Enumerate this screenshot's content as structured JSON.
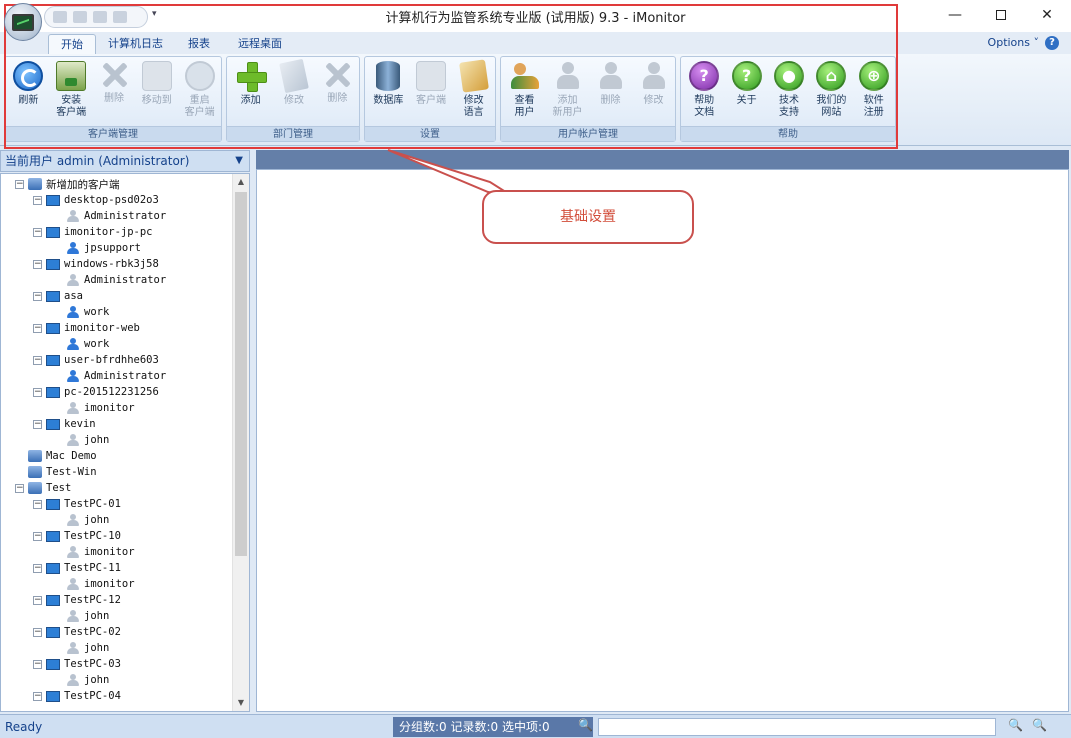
{
  "window": {
    "title": "计算机行为监管系统专业版 (试用版) 9.3 - iMonitor",
    "minimize": "—",
    "close": "✕",
    "qat_dropdown": "▾"
  },
  "tabs": [
    {
      "label": "开始",
      "active": true
    },
    {
      "label": "计算机日志",
      "active": false
    },
    {
      "label": "报表",
      "active": false
    },
    {
      "label": "远程桌面",
      "active": false
    }
  ],
  "options_label": "Options ˅",
  "help_label": "?",
  "ribbon": {
    "groups": [
      {
        "label": "客户端管理",
        "buttons": [
          {
            "label": "刷新",
            "icon": "refresh-icon",
            "enabled": true
          },
          {
            "label": "安装\n客户端",
            "icon": "install-client-icon",
            "enabled": true
          },
          {
            "label": "删除",
            "icon": "delete-icon",
            "enabled": false
          },
          {
            "label": "移动到",
            "icon": "move-icon",
            "enabled": false
          },
          {
            "label": "重启\n客户端",
            "icon": "restart-icon",
            "enabled": false
          }
        ]
      },
      {
        "label": "部门管理",
        "buttons": [
          {
            "label": "添加",
            "icon": "add-icon",
            "enabled": true
          },
          {
            "label": "修改",
            "icon": "edit-icon",
            "enabled": false
          },
          {
            "label": "删除",
            "icon": "delete-icon",
            "enabled": false
          }
        ]
      },
      {
        "label": "设置",
        "buttons": [
          {
            "label": "数据库",
            "icon": "database-icon",
            "enabled": true
          },
          {
            "label": "客户端",
            "icon": "client-settings-icon",
            "enabled": false
          },
          {
            "label": "修改\n语言",
            "icon": "language-icon",
            "enabled": true
          }
        ]
      },
      {
        "label": "用户帐户管理",
        "buttons": [
          {
            "label": "查看\n用户",
            "icon": "users-icon",
            "enabled": true
          },
          {
            "label": "添加\n新用户",
            "icon": "add-user-icon",
            "enabled": false
          },
          {
            "label": "删除",
            "icon": "delete-user-icon",
            "enabled": false
          },
          {
            "label": "修改",
            "icon": "edit-user-icon",
            "enabled": false
          }
        ]
      },
      {
        "label": "帮助",
        "buttons": [
          {
            "label": "帮助\n文档",
            "icon": "help-doc-icon",
            "enabled": true,
            "glyph": "?"
          },
          {
            "label": "关于",
            "icon": "about-icon",
            "enabled": true,
            "glyph": "?"
          },
          {
            "label": "技术\n支持",
            "icon": "support-icon",
            "enabled": true,
            "glyph": "●"
          },
          {
            "label": "我们的\n网站",
            "icon": "home-icon",
            "enabled": true,
            "glyph": "⌂"
          },
          {
            "label": "软件\n注册",
            "icon": "cart-icon",
            "enabled": true,
            "glyph": "⊕"
          }
        ]
      }
    ]
  },
  "current_user": "当前用户 admin (Administrator)",
  "current_user_dropdown": "▼",
  "tree": [
    {
      "label": "新增加的客户端",
      "level": 0,
      "type": "group",
      "toggle": "−"
    },
    {
      "label": "desktop-psd02o3",
      "level": 1,
      "type": "pc",
      "toggle": "−"
    },
    {
      "label": "Administrator",
      "level": 2,
      "type": "user-gray"
    },
    {
      "label": "imonitor-jp-pc",
      "level": 1,
      "type": "pc",
      "toggle": "−"
    },
    {
      "label": "jpsupport",
      "level": 2,
      "type": "user-blue"
    },
    {
      "label": "windows-rbk3j58",
      "level": 1,
      "type": "pc",
      "toggle": "−"
    },
    {
      "label": "Administrator",
      "level": 2,
      "type": "user-gray"
    },
    {
      "label": "asa",
      "level": 1,
      "type": "pc",
      "toggle": "−"
    },
    {
      "label": "work",
      "level": 2,
      "type": "user-blue"
    },
    {
      "label": "imonitor-web",
      "level": 1,
      "type": "pc",
      "toggle": "−"
    },
    {
      "label": "work",
      "level": 2,
      "type": "user-blue"
    },
    {
      "label": "user-bfrdhhe603",
      "level": 1,
      "type": "pc",
      "toggle": "−"
    },
    {
      "label": "Administrator",
      "level": 2,
      "type": "user-blue"
    },
    {
      "label": "pc-201512231256",
      "level": 1,
      "type": "pc",
      "toggle": "−"
    },
    {
      "label": "imonitor",
      "level": 2,
      "type": "user-gray"
    },
    {
      "label": "kevin",
      "level": 1,
      "type": "pc",
      "toggle": "−"
    },
    {
      "label": "john",
      "level": 2,
      "type": "user-gray"
    },
    {
      "label": "Mac Demo",
      "level": 0,
      "type": "group"
    },
    {
      "label": "Test-Win",
      "level": 0,
      "type": "group"
    },
    {
      "label": "Test",
      "level": 0,
      "type": "group",
      "toggle": "−"
    },
    {
      "label": "TestPC-01",
      "level": 1,
      "type": "pc",
      "toggle": "−"
    },
    {
      "label": "john",
      "level": 2,
      "type": "user-gray"
    },
    {
      "label": "TestPC-10",
      "level": 1,
      "type": "pc",
      "toggle": "−"
    },
    {
      "label": "imonitor",
      "level": 2,
      "type": "user-gray"
    },
    {
      "label": "TestPC-11",
      "level": 1,
      "type": "pc",
      "toggle": "−"
    },
    {
      "label": "imonitor",
      "level": 2,
      "type": "user-gray"
    },
    {
      "label": "TestPC-12",
      "level": 1,
      "type": "pc",
      "toggle": "−"
    },
    {
      "label": "john",
      "level": 2,
      "type": "user-gray"
    },
    {
      "label": "TestPC-02",
      "level": 1,
      "type": "pc",
      "toggle": "−"
    },
    {
      "label": "john",
      "level": 2,
      "type": "user-gray"
    },
    {
      "label": "TestPC-03",
      "level": 1,
      "type": "pc",
      "toggle": "−"
    },
    {
      "label": "john",
      "level": 2,
      "type": "user-gray"
    },
    {
      "label": "TestPC-04",
      "level": 1,
      "type": "pc",
      "toggle": "−"
    }
  ],
  "scroll": {
    "up": "▲",
    "down": "▼"
  },
  "callout_text": "基础设置",
  "status": {
    "ready": "Ready",
    "counts": "分组数:0  记录数:0  选中项:0",
    "search_icon": "🔍",
    "zoom_in": "🔍",
    "zoom_out": "🔍"
  },
  "colors": {
    "highlight": "#e03a3a",
    "callout_border": "#c9504d",
    "callout_text": "#d24d3a",
    "statusbar_accent": "#5a78a8"
  }
}
